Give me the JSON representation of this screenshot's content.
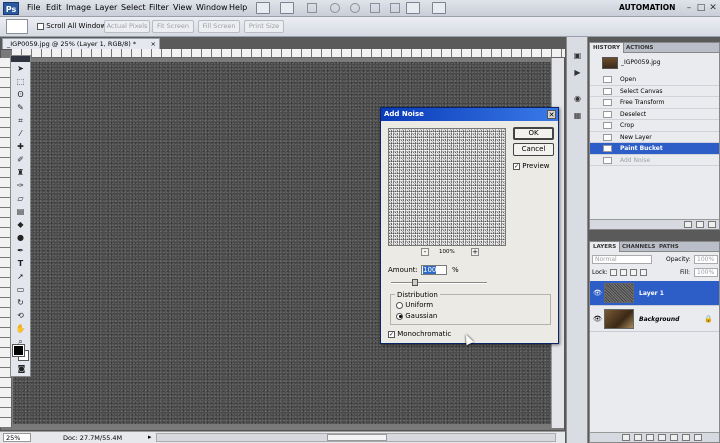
{
  "app": {
    "logo": "Ps",
    "menu": [
      "File",
      "Edit",
      "Image",
      "Layer",
      "Select",
      "Filter",
      "View",
      "Window",
      "Help"
    ],
    "workspace": "AUTOMATION",
    "window_controls": [
      "–",
      "□",
      "✕"
    ]
  },
  "options_bar": {
    "scroll_all_windows": "Scroll All Windows",
    "buttons": [
      "Actual Pixels",
      "Fit Screen",
      "Fill Screen",
      "Print Size"
    ]
  },
  "document": {
    "tab_title": "_IGP0059.jpg @ 25% (Layer 1, RGB/8) *",
    "tab_close": "×",
    "zoom": "25%",
    "doc_size": "Doc: 27.7M/55.4M"
  },
  "history_panel": {
    "tabs": [
      "HISTORY",
      "ACTIONS"
    ],
    "snapshot": "_IGP0059.jpg",
    "items": [
      {
        "label": "Open",
        "state": "normal"
      },
      {
        "label": "Select Canvas",
        "state": "normal"
      },
      {
        "label": "Free Transform",
        "state": "normal"
      },
      {
        "label": "Deselect",
        "state": "normal"
      },
      {
        "label": "Crop",
        "state": "normal"
      },
      {
        "label": "New Layer",
        "state": "normal"
      },
      {
        "label": "Paint Bucket",
        "state": "active"
      },
      {
        "label": "Add Noise",
        "state": "dim"
      }
    ]
  },
  "layers_panel": {
    "tabs": [
      "LAYERS",
      "CHANNELS",
      "PATHS"
    ],
    "blend_mode": "Normal",
    "opacity_label": "Opacity:",
    "opacity_value": "100%",
    "lock_label": "Lock:",
    "fill_label": "Fill:",
    "fill_value": "100%",
    "layers": [
      {
        "name": "Layer 1",
        "active": true
      },
      {
        "name": "Background",
        "active": false,
        "locked": true
      }
    ]
  },
  "dialog": {
    "title": "Add Noise",
    "close": "✕",
    "ok": "OK",
    "cancel": "Cancel",
    "preview_label": "Preview",
    "preview_checked": true,
    "zoom_minus": "-",
    "zoom_plus": "+",
    "zoom_value": "100%",
    "amount_label": "Amount:",
    "amount_value": "100",
    "amount_unit": "%",
    "amount_slider_fraction": 0.25,
    "distribution_label": "Distribution",
    "uniform_label": "Uniform",
    "gaussian_label": "Gaussian",
    "selected_distribution": "Gaussian",
    "monochromatic_label": "Monochromatic",
    "monochromatic_checked": true
  },
  "colors": {
    "selection_blue": "#2d5ec8",
    "title_bar_blue": "#0a3ab8",
    "foreground": "#000000",
    "background": "#ffffff"
  }
}
